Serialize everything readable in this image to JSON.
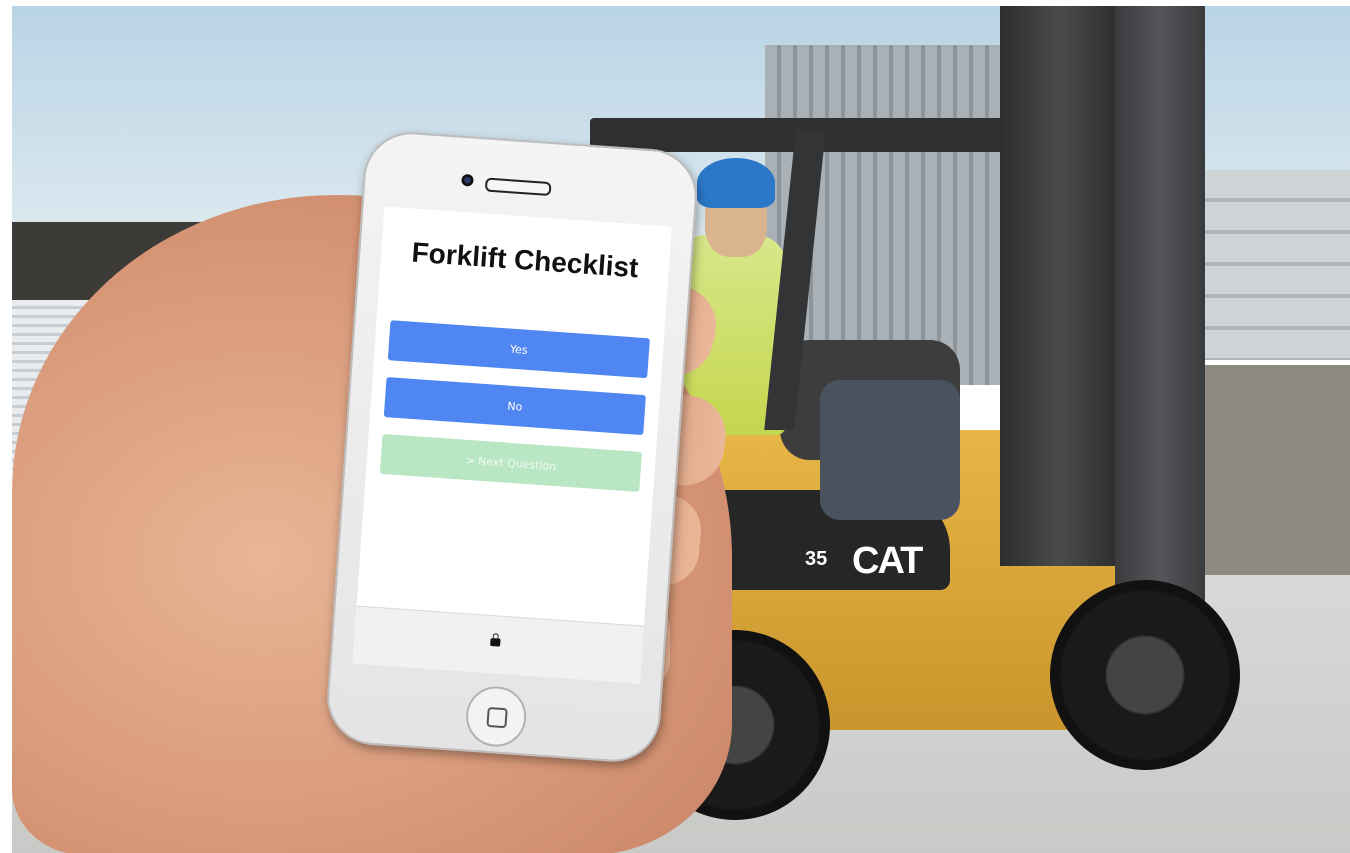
{
  "phone": {
    "title": "Forklift Checklist",
    "buttons": {
      "yes": "Yes",
      "no": "No",
      "next": "> Next Question"
    }
  },
  "forklift": {
    "model_number": "35",
    "brand": "CAT"
  },
  "colors": {
    "button_blue": "#4f86f1",
    "button_next": "#b9e6c3",
    "forklift_yellow": "#e6b646"
  }
}
